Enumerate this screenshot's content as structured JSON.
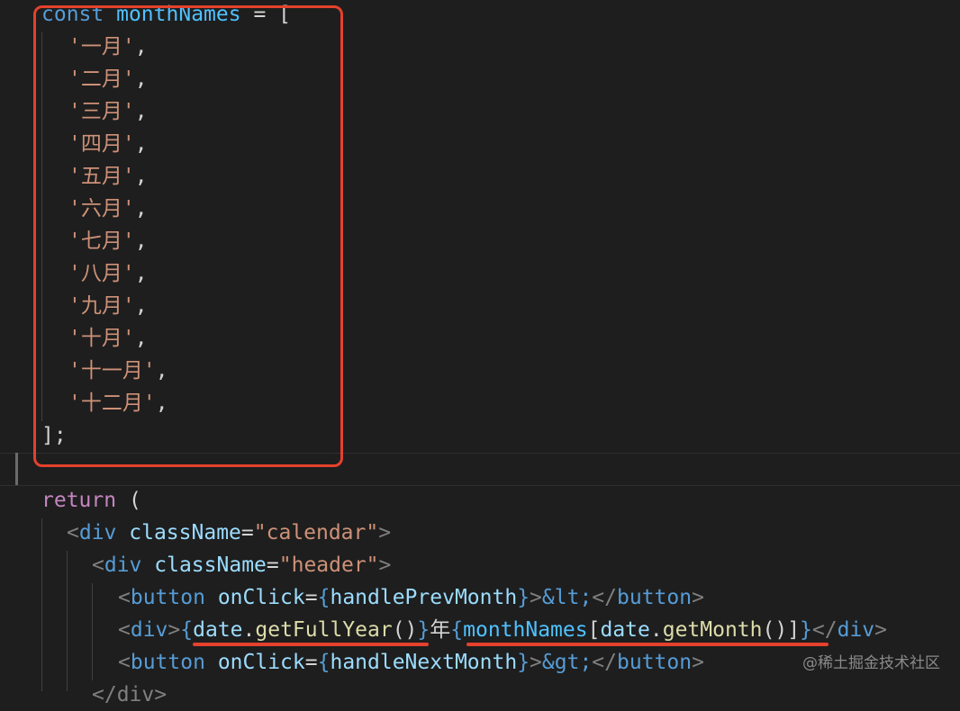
{
  "code": {
    "line1": {
      "kw": "const",
      "name": "monthNames",
      "op": " = ["
    },
    "months": [
      "'一月'",
      "'二月'",
      "'三月'",
      "'四月'",
      "'五月'",
      "'六月'",
      "'七月'",
      "'八月'",
      "'九月'",
      "'十月'",
      "'十一月'",
      "'十二月'"
    ],
    "comma": ",",
    "close": "];",
    "return_kw": "return",
    "return_paren": " (",
    "div_tag": "div",
    "button_tag": "button",
    "classname_attr": "className",
    "calendar_class": "\"calendar\"",
    "header_class": "\"header\"",
    "onclick_attr": "onClick",
    "prev_handler": "handlePrevMonth",
    "next_handler": "handleNextMonth",
    "lt_entity": "&lt;",
    "gt_entity": "&gt;",
    "date_var": "date",
    "get_full_year": "getFullYear",
    "get_month": "getMonth",
    "year_char": "年",
    "month_names_ref": "monthNames",
    "partial_close": "</div>"
  },
  "colors": {
    "highlight": "#e5412d",
    "background": "#1e1e1e"
  },
  "watermark": "@稀土掘金技术社区"
}
